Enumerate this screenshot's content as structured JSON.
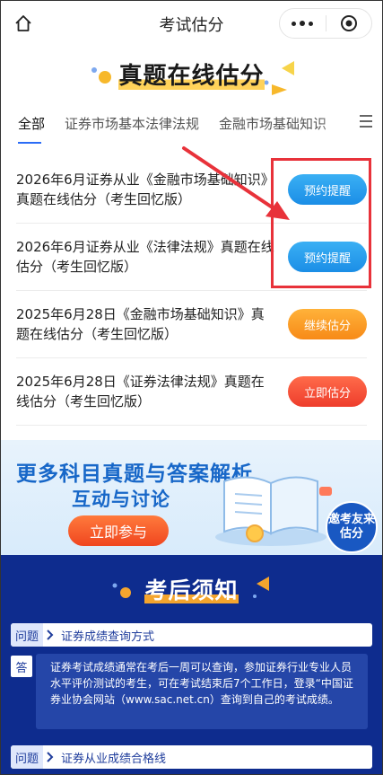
{
  "header": {
    "title": "考试估分"
  },
  "banner": {
    "title": "真题在线估分"
  },
  "tabs": [
    {
      "label": "全部"
    },
    {
      "label": "证券市场基本法律法规"
    },
    {
      "label": "金融市场基础知识"
    }
  ],
  "exams": [
    {
      "title": "2026年6月证券从业《金融市场基础知识》真题在线估分（考生回忆版）",
      "button": "预约提醒"
    },
    {
      "title": "2026年6月证券从业《法律法规》真题在线估分（考生回忆版）",
      "button": "预约提醒"
    },
    {
      "title": "2025年6月28日《金融市场基础知识》真题在线估分（考生回忆版）",
      "button": "继续估分"
    },
    {
      "title": "2025年6月28日《证券法律法规》真题在线估分（考生回忆版）",
      "button": "立即估分"
    }
  ],
  "promo": {
    "line1": "更多科目真题与答案解析",
    "line2": "互动与讨论",
    "join_label": "立即参与",
    "invite_label": "邀考友来估分"
  },
  "notice": {
    "title": "考后须知",
    "q_tag": "问题",
    "a_tag": "答",
    "items": [
      {
        "question": "证券成绩查询方式",
        "answer": "证券考试成绩通常在考后一周可以查询，参加证券行业专业人员水平评价测试的考生，可在考试结束后7个工作日，登录“中国证券业协会网站（www.sac.net.cn）查询到自己的考试成绩。"
      },
      {
        "question": "证券从业成绩合格线"
      }
    ]
  },
  "colors": {
    "blue_button": "#1b8ee6",
    "orange_button": "#f78a17",
    "red_button": "#ee3d2c",
    "notice_bg": "#0e2c8e",
    "highlight_box": "#e8323a"
  }
}
